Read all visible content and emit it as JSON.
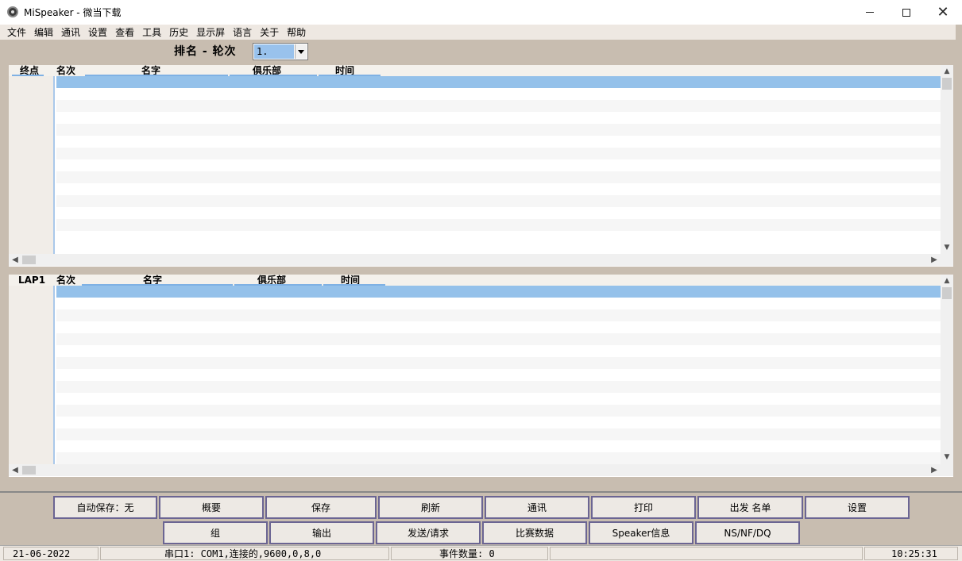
{
  "window": {
    "title": "MiSpeaker - 微当下载"
  },
  "menu": [
    "文件",
    "编辑",
    "通讯",
    "设置",
    "查看",
    "工具",
    "历史",
    "显示屏",
    "语言",
    "关于",
    "帮助"
  ],
  "ranking": {
    "label": "排名 - 轮次",
    "selected": "1."
  },
  "grid_top": {
    "corner": "终点",
    "columns": [
      "名次",
      "名字",
      "俱乐部",
      "时间"
    ]
  },
  "grid_bottom": {
    "corner": "LAP1",
    "columns": [
      "名次",
      "名字",
      "俱乐部",
      "时间"
    ]
  },
  "buttons": {
    "autosave": "自动保存：无",
    "overview": "概要",
    "save": "保存",
    "refresh": "刷新",
    "comm": "通讯",
    "print": "打印",
    "start_list": "出发 名单",
    "settings": "设置",
    "group": "组",
    "output": "输出",
    "send_request": "发送/请求",
    "race_data": "比赛数据",
    "speaker_info": "Speaker信息",
    "ns_nf_dq": "NS/NF/DQ"
  },
  "status": {
    "date": "21-06-2022",
    "port": "串口1: COM1,连接的,9600,0,8,0",
    "events": "事件数量: 0",
    "time": "10:25:31"
  }
}
